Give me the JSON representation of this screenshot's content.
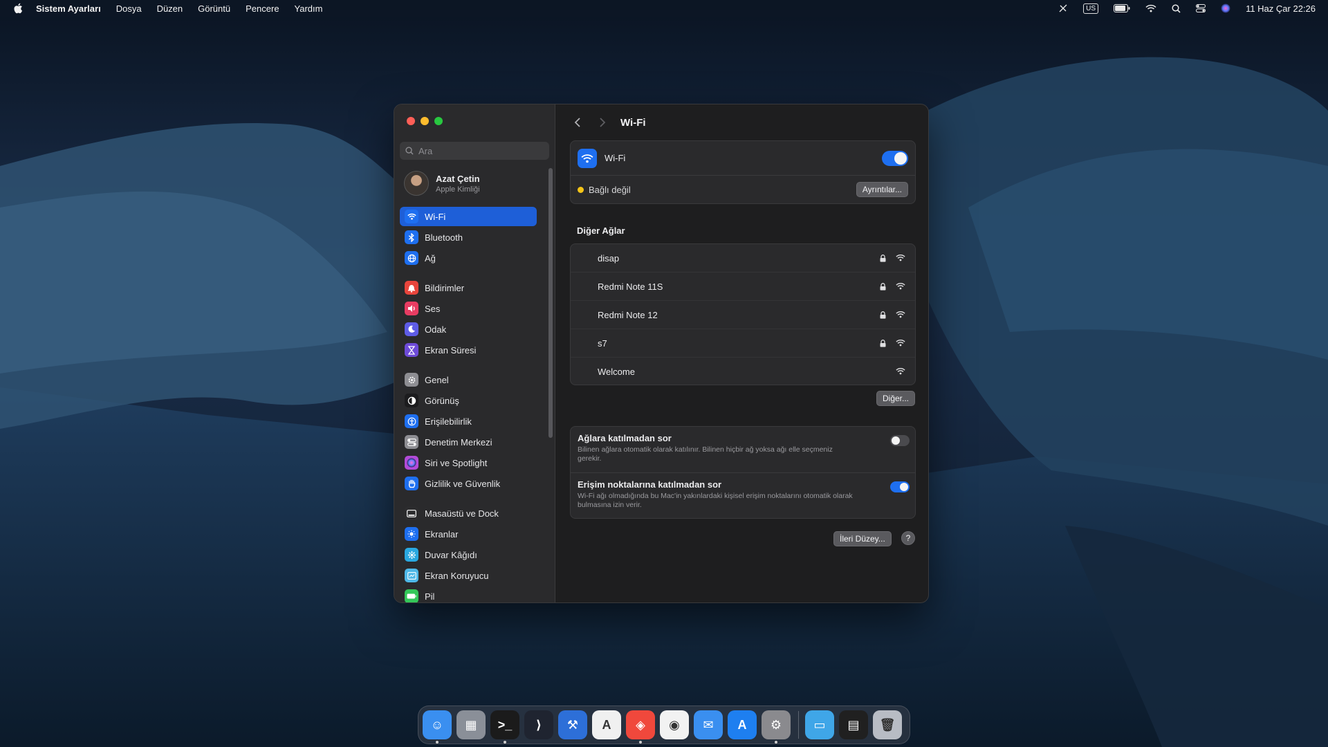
{
  "menubar": {
    "app_name": "Sistem Ayarları",
    "menus": [
      "Dosya",
      "Düzen",
      "Görüntü",
      "Pencere",
      "Yardım"
    ],
    "keyboard_layout": "US",
    "datetime": "11 Haz Çar  22:26"
  },
  "sidebar": {
    "search_placeholder": "Ara",
    "profile": {
      "name": "Azat Çetin",
      "subtitle": "Apple Kimliği"
    },
    "groups": [
      [
        {
          "label": "Wi-Fi",
          "icon": "wifi-icon",
          "color": "#1e6ff0",
          "selected": true
        },
        {
          "label": "Bluetooth",
          "icon": "bluetooth-icon",
          "color": "#1e6ff0"
        },
        {
          "label": "Ağ",
          "icon": "globe-icon",
          "color": "#1e6ff0"
        }
      ],
      [
        {
          "label": "Bildirimler",
          "icon": "bell-icon",
          "color": "#e8453c"
        },
        {
          "label": "Ses",
          "icon": "speaker-icon",
          "color": "#e83c62"
        },
        {
          "label": "Odak",
          "icon": "moon-icon",
          "color": "#5e5ce6"
        },
        {
          "label": "Ekran Süresi",
          "icon": "hourglass-icon",
          "color": "#6e4bd8"
        }
      ],
      [
        {
          "label": "Genel",
          "icon": "gear-icon",
          "color": "#8e8e93"
        },
        {
          "label": "Görünüş",
          "icon": "appearance-icon",
          "color": "#1c1c1e"
        },
        {
          "label": "Erişilebilirlik",
          "icon": "accessibility-icon",
          "color": "#1e6ff0"
        },
        {
          "label": "Denetim Merkezi",
          "icon": "control-center-icon",
          "color": "#8e8e93"
        },
        {
          "label": "Siri ve Spotlight",
          "icon": "siri-icon",
          "color": "#b24bd8"
        },
        {
          "label": "Gizlilik ve Güvenlik",
          "icon": "hand-icon",
          "color": "#1e6ff0"
        }
      ],
      [
        {
          "label": "Masaüstü ve Dock",
          "icon": "dock-icon",
          "color": "#2c2c2e"
        },
        {
          "label": "Ekranlar",
          "icon": "display-icon",
          "color": "#1e6ff0"
        },
        {
          "label": "Duvar Kâğıdı",
          "icon": "wallpaper-icon",
          "color": "#2aa8e0"
        },
        {
          "label": "Ekran Koruyucu",
          "icon": "screensaver-icon",
          "color": "#4fb8e8"
        },
        {
          "label": "Pil",
          "icon": "battery-icon",
          "color": "#34c759"
        }
      ]
    ]
  },
  "content": {
    "title": "Wi-Fi",
    "wifi_label": "Wi-Fi",
    "wifi_enabled": true,
    "status_text": "Bağlı değil",
    "details_button": "Ayrıntılar...",
    "other_networks_title": "Diğer Ağlar",
    "networks": [
      {
        "name": "disap",
        "locked": true
      },
      {
        "name": "Redmi Note 11S",
        "locked": true
      },
      {
        "name": "Redmi Note 12",
        "locked": true
      },
      {
        "name": "s7",
        "locked": true
      },
      {
        "name": "Welcome",
        "locked": false
      }
    ],
    "other_button": "Diğer...",
    "options": [
      {
        "title": "Ağlara katılmadan sor",
        "desc": "Bilinen ağlara otomatik olarak katılınır. Bilinen hiçbir ağ yoksa ağı elle seçmeniz gerekir.",
        "enabled": false
      },
      {
        "title": "Erişim noktalarına katılmadan sor",
        "desc": "Wi-Fi ağı olmadığında bu Mac'in yakınlardaki kişisel erişim noktalarını otomatik olarak bulmasına izin verir.",
        "enabled": true
      }
    ],
    "advanced_button": "İleri Düzey...",
    "help_button": "?"
  },
  "dock": {
    "apps": [
      {
        "name": "finder",
        "color": "#3a8ff0",
        "glyph": "☺",
        "running": true
      },
      {
        "name": "launchpad",
        "color": "#8a8f98",
        "glyph": "▦",
        "running": false
      },
      {
        "name": "terminal",
        "color": "#1b1b1b",
        "glyph": ">_",
        "running": true
      },
      {
        "name": "vscode",
        "color": "#1f2430",
        "glyph": "⟩",
        "running": false
      },
      {
        "name": "xcode",
        "color": "#2d6fd8",
        "glyph": "⚒",
        "running": false
      },
      {
        "name": "instruments",
        "color": "#f0f0f0",
        "glyph": "A",
        "running": false
      },
      {
        "name": "brave",
        "color": "#f0483c",
        "glyph": "◈",
        "running": true
      },
      {
        "name": "chrome",
        "color": "#f2f2f2",
        "glyph": "◉",
        "running": false
      },
      {
        "name": "mail",
        "color": "#3a8ff0",
        "glyph": "✉",
        "running": false
      },
      {
        "name": "app-store",
        "color": "#1e7ff0",
        "glyph": "A",
        "running": false
      },
      {
        "name": "system-settings",
        "color": "#8a8a8e",
        "glyph": "⚙",
        "running": true
      }
    ],
    "right_items": [
      {
        "name": "downloads-folder",
        "color": "#3fa6e8",
        "glyph": "▭"
      },
      {
        "name": "screenshot-stack",
        "color": "#202020",
        "glyph": "▤"
      },
      {
        "name": "trash",
        "color": "#b8bcc4",
        "glyph": "🗑"
      }
    ]
  }
}
